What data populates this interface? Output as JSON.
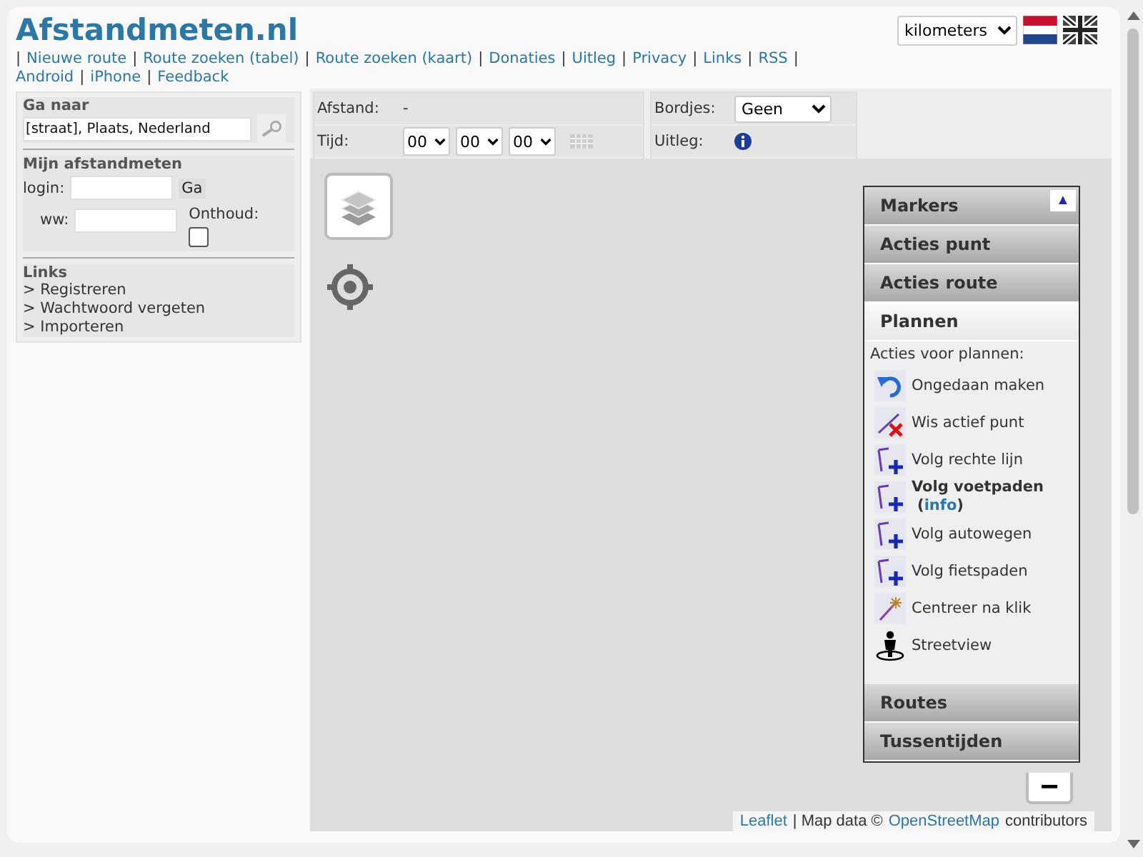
{
  "logo": "Afstandmeten.nl",
  "unit_select": {
    "value": "kilometers"
  },
  "nav": {
    "separator": "|",
    "links": [
      "Nieuwe route",
      "Route zoeken (tabel)",
      "Route zoeken (kaart)",
      "Donaties",
      "Uitleg",
      "Privacy",
      "Links",
      "RSS",
      "Android",
      "iPhone",
      "Feedback"
    ]
  },
  "sidebar": {
    "goto": {
      "title": "Ga naar",
      "placeholder": "[straat], Plaats, Nederland"
    },
    "login": {
      "title": "Mijn afstandmeten",
      "login_label": "login:",
      "go_button": "Ga",
      "password_label": "ww:",
      "remember_label": "Onthoud:",
      "remember": false
    },
    "links": {
      "title": "Links",
      "items": [
        "> Registreren",
        "> Wachtwoord vergeten",
        "> Importeren"
      ]
    }
  },
  "route_info": {
    "distance_label": "Afstand:",
    "distance_value": "-",
    "time_label": "Tijd:",
    "time": [
      "00",
      "00",
      "00"
    ],
    "signs_label": "Bordjes:",
    "signs_value": "Geen",
    "help_label": "Uitleg:"
  },
  "panel": {
    "sections": [
      {
        "title": "Markers",
        "expanded": false
      },
      {
        "title": "Acties punt",
        "expanded": false
      },
      {
        "title": "Acties route",
        "expanded": false
      },
      {
        "title": "Plannen",
        "expanded": true,
        "intro": "Acties voor plannen:",
        "actions": [
          {
            "kind": "undo",
            "label": "Ongedaan maken",
            "active": false
          },
          {
            "kind": "delete",
            "label": "Wis actief punt",
            "active": false
          },
          {
            "kind": "follow",
            "label": "Volg rechte lijn",
            "active": false
          },
          {
            "kind": "follow",
            "label": "Volg voetpaden",
            "active": true,
            "link_open": "(",
            "link": "info",
            "link_close": ")"
          },
          {
            "kind": "follow",
            "label": "Volg autowegen",
            "active": false
          },
          {
            "kind": "follow",
            "label": "Volg fietspaden",
            "active": false
          },
          {
            "kind": "center",
            "label": "Centreer na klik",
            "active": false
          },
          {
            "kind": "streetview",
            "label": "Streetview",
            "active": false
          }
        ]
      },
      {
        "title": "Routes",
        "expanded": false
      },
      {
        "title": "Tussentijden",
        "expanded": false
      }
    ],
    "collapse_button": "▲"
  },
  "zoom_out": "−",
  "attribution": {
    "link1": "Leaflet",
    "text1": "| Map data ©",
    "link2": "OpenStreetMap",
    "text2": "contributors"
  }
}
